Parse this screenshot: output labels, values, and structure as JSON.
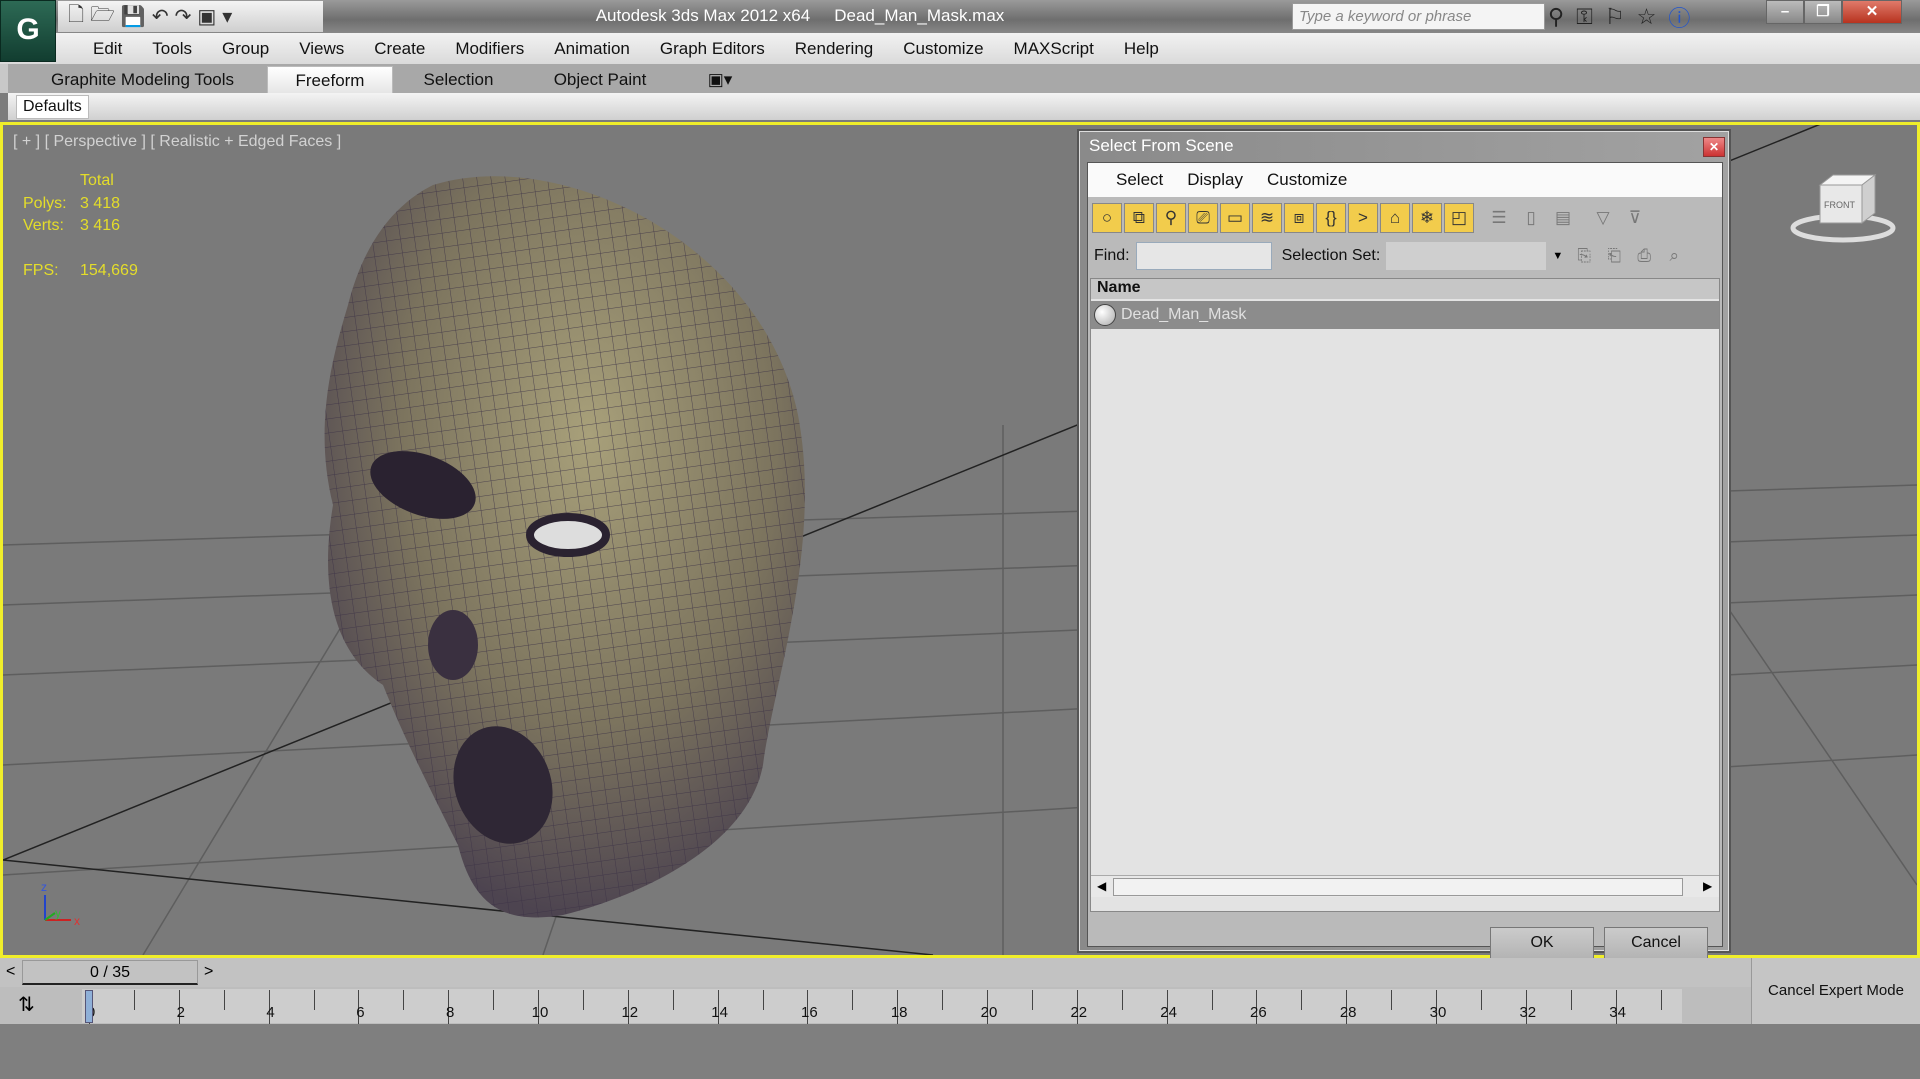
{
  "title": {
    "app": "Autodesk 3ds Max  2012 x64",
    "file": "Dead_Man_Mask.max"
  },
  "search": {
    "placeholder": "Type a keyword or phrase"
  },
  "menu": [
    "Edit",
    "Tools",
    "Group",
    "Views",
    "Create",
    "Modifiers",
    "Animation",
    "Graph Editors",
    "Rendering",
    "Customize",
    "MAXScript",
    "Help"
  ],
  "ribbon": {
    "tabs": [
      "Graphite Modeling Tools",
      "Freeform",
      "Selection",
      "Object Paint"
    ],
    "active": "Freeform",
    "panel": "Defaults"
  },
  "viewport": {
    "label": "[ + ] [ Perspective ] [ Realistic + Edged Faces ]",
    "stats": {
      "header": "Total",
      "polys_label": "Polys:",
      "polys": "3 418",
      "verts_label": "Verts:",
      "verts": "3 416",
      "fps_label": "FPS:",
      "fps": "154,669"
    },
    "viewcube": "FRONT",
    "axes": [
      "z",
      "y",
      "x"
    ]
  },
  "dialog": {
    "title": "Select From Scene",
    "menu": [
      "Select",
      "Display",
      "Customize"
    ],
    "find_label": "Find:",
    "find_value": "",
    "selset_label": "Selection Set:",
    "column": "Name",
    "rows": [
      "Dead_Man_Mask"
    ],
    "ok": "OK",
    "cancel": "Cancel"
  },
  "timeline": {
    "frame": "0 / 35",
    "prev": "<",
    "next": ">",
    "ticks": [
      "0",
      "2",
      "4",
      "6",
      "8",
      "10",
      "12",
      "14",
      "16",
      "18",
      "20",
      "22",
      "24",
      "26",
      "28",
      "30",
      "32",
      "34"
    ]
  },
  "expert": "Cancel Expert Mode",
  "colors": {
    "selection_border": "#f0ee2a",
    "stats": "#e4dd2a",
    "tool_active": "#f2cc4c"
  }
}
